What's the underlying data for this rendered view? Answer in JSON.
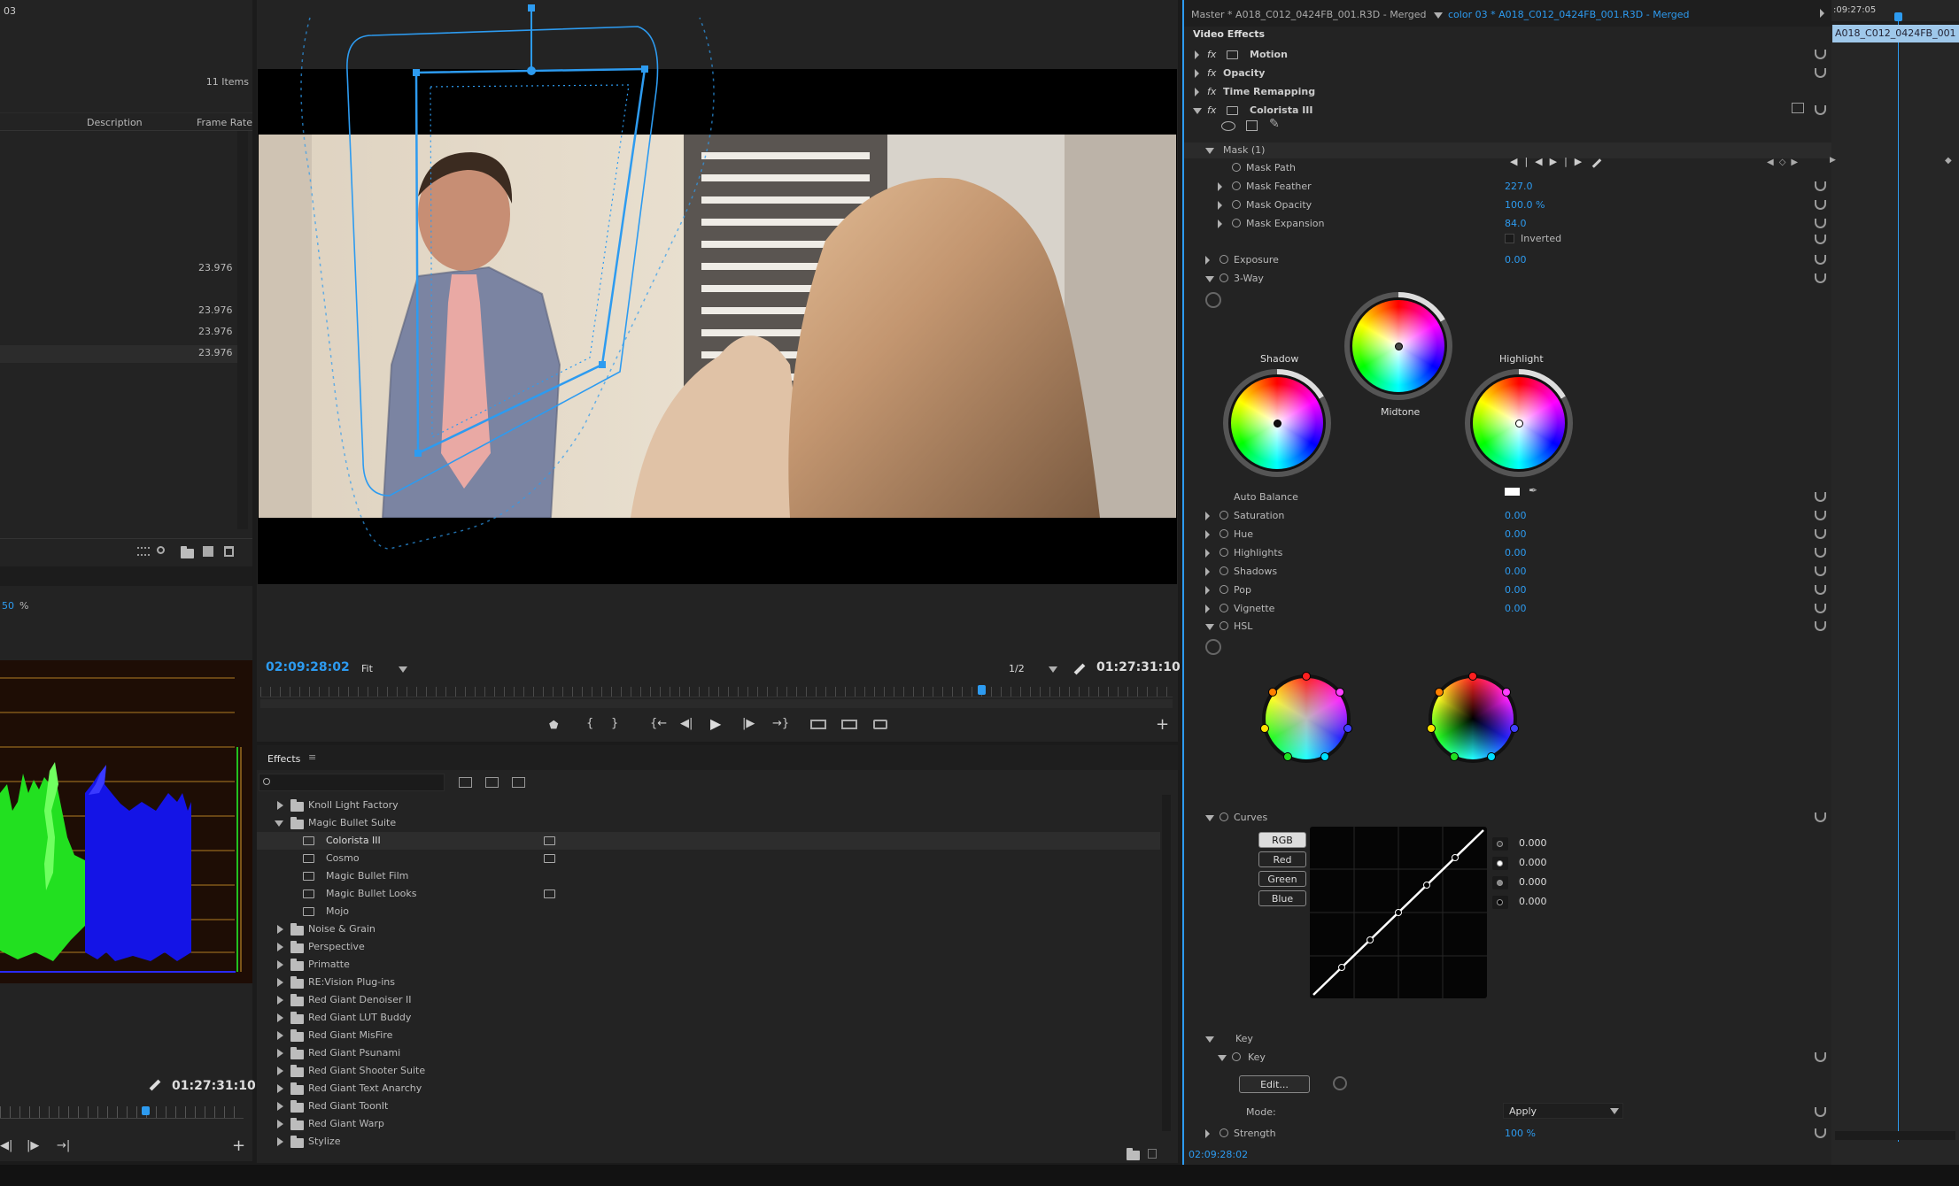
{
  "project": {
    "title_fragment": "03",
    "items_count": "11 Items",
    "col_description": "Description",
    "col_frame_rate": "Frame Rate",
    "frame_rates": [
      "23.976",
      "23.976",
      "23.976",
      "23.976"
    ]
  },
  "scope": {
    "zoom_value": "50",
    "zoom_unit": "%",
    "timecode": "01:27:31:10"
  },
  "program": {
    "timecode_left": "02:09:28:02",
    "fit": "Fit",
    "resolution": "1/2",
    "timecode_right": "01:27:31:10"
  },
  "effects_panel": {
    "title": "Effects",
    "search_placeholder": "",
    "items": [
      {
        "label": "Knoll Light Factory",
        "type": "folder",
        "open": false,
        "accel": false
      },
      {
        "label": "Magic Bullet Suite",
        "type": "folder",
        "open": true,
        "accel": false
      },
      {
        "label": "Colorista III",
        "type": "effect",
        "accel": true,
        "selected": true
      },
      {
        "label": "Cosmo",
        "type": "effect",
        "accel": true
      },
      {
        "label": "Magic Bullet Film",
        "type": "effect",
        "accel": false
      },
      {
        "label": "Magic Bullet Looks",
        "type": "effect",
        "accel": true
      },
      {
        "label": "Mojo",
        "type": "effect",
        "accel": false
      },
      {
        "label": "Noise & Grain",
        "type": "folder",
        "open": false
      },
      {
        "label": "Perspective",
        "type": "folder",
        "open": false
      },
      {
        "label": "Primatte",
        "type": "folder",
        "open": false
      },
      {
        "label": "RE:Vision Plug-ins",
        "type": "folder",
        "open": false
      },
      {
        "label": "Red Giant Denoiser II",
        "type": "folder",
        "open": false
      },
      {
        "label": "Red Giant LUT Buddy",
        "type": "folder",
        "open": false
      },
      {
        "label": "Red Giant MisFire",
        "type": "folder",
        "open": false
      },
      {
        "label": "Red Giant Psunami",
        "type": "folder",
        "open": false
      },
      {
        "label": "Red Giant Shooter Suite",
        "type": "folder",
        "open": false
      },
      {
        "label": "Red Giant Text Anarchy",
        "type": "folder",
        "open": false
      },
      {
        "label": "Red Giant ToonIt",
        "type": "folder",
        "open": false
      },
      {
        "label": "Red Giant Warp",
        "type": "folder",
        "open": false
      },
      {
        "label": "Stylize",
        "type": "folder",
        "open": false
      }
    ]
  },
  "ec": {
    "master": "Master * A018_C012_0424FB_001.R3D - Merged",
    "clip": "color 03 * A018_C012_0424FB_001.R3D - Merged",
    "video_effects": "Video Effects",
    "motion": "Motion",
    "opacity": "Opacity",
    "time_remapping": "Time Remapping",
    "colorista": "Colorista III",
    "mask": "Mask (1)",
    "mask_path": "Mask Path",
    "mask_feather": "Mask Feather",
    "mask_feather_val": "227.0",
    "mask_opacity": "Mask Opacity",
    "mask_opacity_val": "100.0 %",
    "mask_expansion": "Mask Expansion",
    "mask_expansion_val": "84.0",
    "inverted": "Inverted",
    "exposure": "Exposure",
    "exposure_val": "0.00",
    "threeway": "3-Way",
    "shadow": "Shadow",
    "midtone": "Midtone",
    "highlight": "Highlight",
    "auto_balance": "Auto Balance",
    "saturation": "Saturation",
    "saturation_val": "0.00",
    "hue": "Hue",
    "hue_val": "0.00",
    "highlights": "Highlights",
    "highlights_val": "0.00",
    "shadows": "Shadows",
    "shadows_val": "0.00",
    "pop": "Pop",
    "pop_val": "0.00",
    "vignette": "Vignette",
    "vignette_val": "0.00",
    "hsl": "HSL",
    "curves": "Curves",
    "curve_buttons": [
      "RGB",
      "Red",
      "Green",
      "Blue"
    ],
    "curve_values": [
      "0.000",
      "0.000",
      "0.000",
      "0.000"
    ],
    "key_group": "Key",
    "key": "Key",
    "edit": "Edit...",
    "mode": "Mode:",
    "mode_val": "Apply",
    "strength": "Strength",
    "strength_val": "100 %",
    "bottom_timecode": "02:09:28:02"
  },
  "timeline": {
    "timecode": ":09:27:05",
    "clip": "A018_C012_0424FB_001"
  }
}
